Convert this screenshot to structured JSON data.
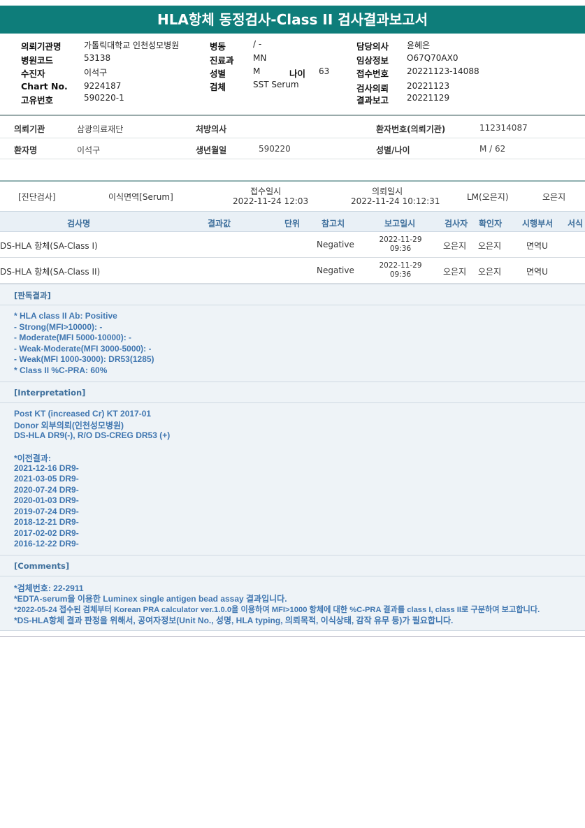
{
  "title": "HLA항체 동정검사-Class II 검사결과보고서",
  "header": {
    "left": [
      {
        "label": "의뢰기관명",
        "value": "가톨릭대학교 인천성모병원"
      },
      {
        "label": "병원코드",
        "value": "53138"
      },
      {
        "label": "수진자",
        "value": "이석구"
      },
      {
        "label": "Chart No.",
        "value": "9224187"
      },
      {
        "label": "고유번호",
        "value": "590220-1"
      }
    ],
    "middle": [
      {
        "label": "병동",
        "value": "/ -"
      },
      {
        "label": "진료과",
        "value": "MN"
      },
      {
        "label": "성별",
        "value": "M"
      },
      {
        "label": "검체",
        "value": "SST Serum"
      }
    ],
    "age_label": "나이",
    "age_value": "63",
    "right": [
      {
        "label": "담당의사",
        "value": "윤혜은"
      },
      {
        "label": "임상정보",
        "value": "O67Q70AX0"
      },
      {
        "label": "접수번호",
        "value": "20221123-14088"
      },
      {
        "label": "검사의뢰",
        "value": "20221123"
      },
      {
        "label": "결과보고",
        "value": "20221129"
      }
    ]
  },
  "info": {
    "org_label": "의뢰기관",
    "org_value": "삼광의료재단",
    "doctor_label": "처방의사",
    "doctor_value": "",
    "patient_no_label": "환자번호(의뢰기관)",
    "patient_no_value": "112314087",
    "name_label": "환자명",
    "name_value": "이석구",
    "birth_label": "생년월일",
    "birth_value": "590220",
    "sexage_label": "성별/나이",
    "sexage_value": "M / 62"
  },
  "diag": {
    "type": "[진단검사]",
    "dept": "이식면역[Serum]",
    "received_label": "접수일시",
    "received_value": "2022-11-24  12:03",
    "requested_label": "의뢰일시",
    "requested_value": "2022-11-24  10:12:31",
    "lm": "LM(오은지)",
    "person": "오은지"
  },
  "columns": [
    "검사명",
    "결과값",
    "단위",
    "참고치",
    "보고일시",
    "검사자",
    "확인자",
    "시행부서",
    "서식"
  ],
  "rows": [
    {
      "name": "DS-HLA 항체(SA-Class I)",
      "ref": "Negative",
      "date": "2022-11-29",
      "time": "09:36",
      "tester": "오은지",
      "checker": "오은지",
      "dept": "면역U"
    },
    {
      "name": "DS-HLA 항체(SA-Class II)",
      "ref": "Negative",
      "date": "2022-11-29",
      "time": "09:36",
      "tester": "오은지",
      "checker": "오은지",
      "dept": "면역U"
    }
  ],
  "sections": {
    "judgment_title": "[판독결과]",
    "judgment": [
      "* HLA class II Ab: Positive",
      "- Strong(MFI>10000): -",
      "- Moderate(MFI 5000-10000): -",
      "- Weak-Moderate(MFI 3000-5000): -",
      "- Weak(MFI 1000-3000): DR53(1285)",
      "* Class II %C-PRA: 60%"
    ],
    "interpretation_title": "[Interpretation]",
    "interpretation": [
      "Post KT (increased Cr) KT 2017-01",
      "Donor 외부의뢰(인천성모병원)",
      "DS-HLA DR9(-), R/O DS-CREG DR53 (+)",
      "",
      "*이전결과:",
      "2021-12-16 DR9-",
      "2021-03-05 DR9-",
      "2020-07-24 DR9-",
      "2020-01-03 DR9-",
      "2019-07-24 DR9-",
      "2018-12-21 DR9-",
      "2017-02-02 DR9-",
      "2016-12-22 DR9-"
    ],
    "comments_title": "[Comments]",
    "comments": [
      "*검체번호: 22-2911",
      "*EDTA-serum을 이용한 Luminex single antigen bead assay 결과입니다.",
      "*2022-05-24 접수된 검체부터 Korean PRA calculator ver.1.0.0을 이용하여 MFI>1000 항체에 대한 %C-PRA 결과를 class I, class II로 구분하여 보고합니다.",
      "*DS-HLA항체 결과 판정을 위해서, 공여자정보(Unit No., 성명, HLA typing, 의뢰목적, 이식상태, 감작 유무 등)가 필요합니다."
    ]
  }
}
